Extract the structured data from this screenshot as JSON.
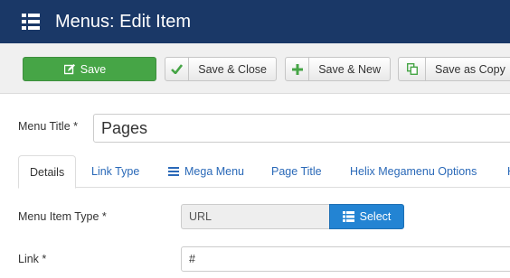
{
  "header": {
    "title": "Menus: Edit Item",
    "icon": "list-icon"
  },
  "toolbar": {
    "save": {
      "label": "Save",
      "icon": "edit-icon",
      "color": "#46a546"
    },
    "save_close": {
      "label": "Save & Close",
      "icon": "check-icon",
      "icon_color": "#46a546"
    },
    "save_new": {
      "label": "Save & New",
      "icon": "plus-icon",
      "icon_color": "#46a546"
    },
    "save_copy": {
      "label": "Save as Copy",
      "icon": "copy-icon",
      "icon_color": "#46a546"
    }
  },
  "form": {
    "menu_title": {
      "label": "Menu Title *",
      "value": "Pages"
    },
    "tabs": [
      {
        "label": "Details",
        "active": true
      },
      {
        "label": "Link Type"
      },
      {
        "label": "Mega Menu",
        "icon": "bars-icon"
      },
      {
        "label": "Page Title"
      },
      {
        "label": "Helix Megamenu Options"
      },
      {
        "label": "H"
      }
    ],
    "menu_item_type": {
      "label": "Menu Item Type *",
      "value": "URL",
      "button_label": "Select",
      "button_icon": "list-icon"
    },
    "link": {
      "label": "Link *",
      "value": "#"
    }
  },
  "colors": {
    "header_bg": "#1a3867",
    "accent": "#2384d3",
    "success": "#46a546"
  }
}
